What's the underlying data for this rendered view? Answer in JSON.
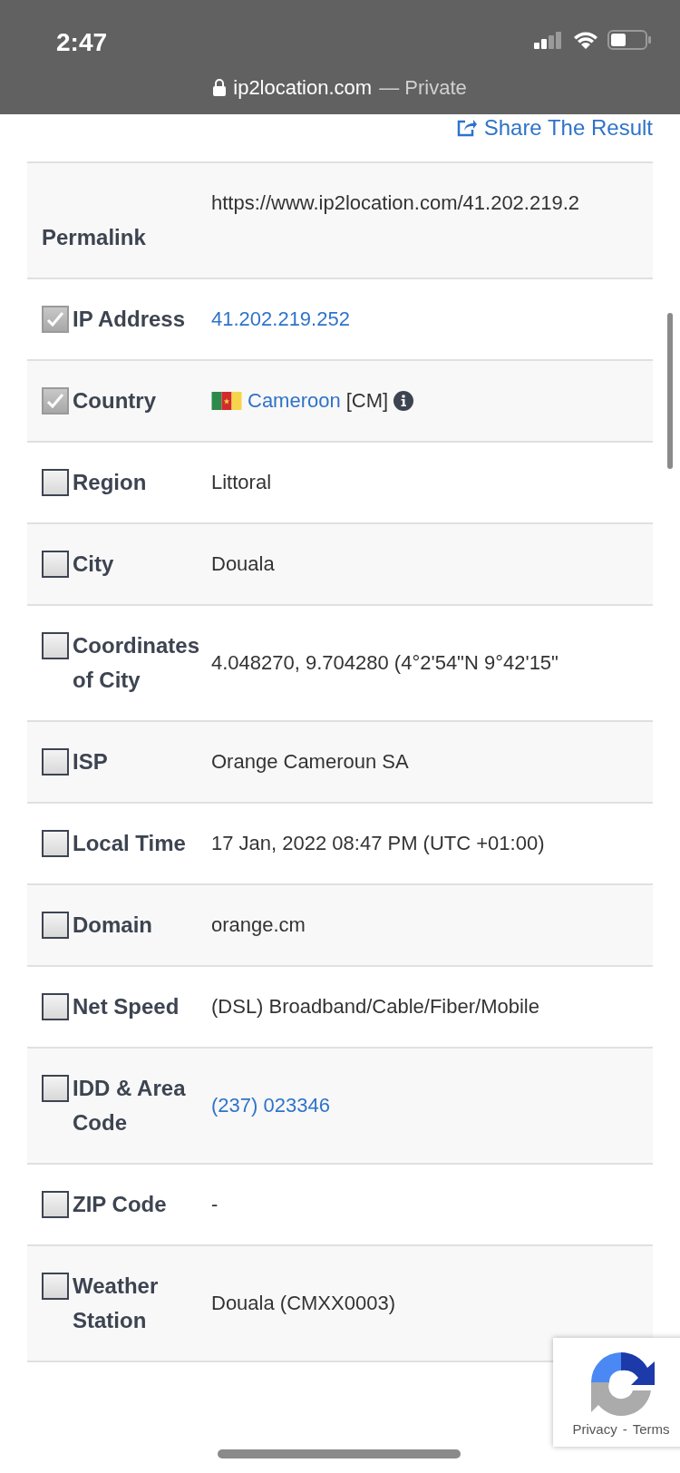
{
  "status_bar": {
    "time": "2:47"
  },
  "address_bar": {
    "domain": "ip2location.com",
    "mode": "— Private"
  },
  "share_link": "Share The Result",
  "rows": [
    {
      "kind": "permalink",
      "label": "Permalink",
      "value": "https://www.ip2location.com/41.202.219.2"
    },
    {
      "kind": "link",
      "label": "IP Address",
      "checked": true,
      "value": "41.202.219.252"
    },
    {
      "kind": "country",
      "label": "Country",
      "checked": true,
      "value": "Cameroon",
      "code": "[CM]"
    },
    {
      "kind": "text",
      "label": "Region",
      "checked": false,
      "value": "Littoral"
    },
    {
      "kind": "text",
      "label": "City",
      "checked": false,
      "value": "Douala"
    },
    {
      "kind": "text",
      "label": "Coordinates of City",
      "checked": false,
      "value": "4.048270, 9.704280 (4°2'54\"N   9°42'15\""
    },
    {
      "kind": "text",
      "label": "ISP",
      "checked": false,
      "value": "Orange Cameroun SA"
    },
    {
      "kind": "text",
      "label": "Local Time",
      "checked": false,
      "value": "17 Jan, 2022 08:47 PM (UTC +01:00)"
    },
    {
      "kind": "text",
      "label": "Domain",
      "checked": false,
      "value": "orange.cm"
    },
    {
      "kind": "text",
      "label": "Net Speed",
      "checked": false,
      "value": "(DSL) Broadband/Cable/Fiber/Mobile"
    },
    {
      "kind": "link",
      "label": "IDD & Area Code",
      "checked": false,
      "value": "(237) 023346"
    },
    {
      "kind": "text",
      "label": "ZIP Code",
      "checked": false,
      "value": "-"
    },
    {
      "kind": "text",
      "label": "Weather Station",
      "checked": false,
      "value": "Douala (CMXX0003)"
    }
  ],
  "recaptcha": {
    "privacy": "Privacy",
    "separator": "-",
    "terms": "Terms"
  }
}
